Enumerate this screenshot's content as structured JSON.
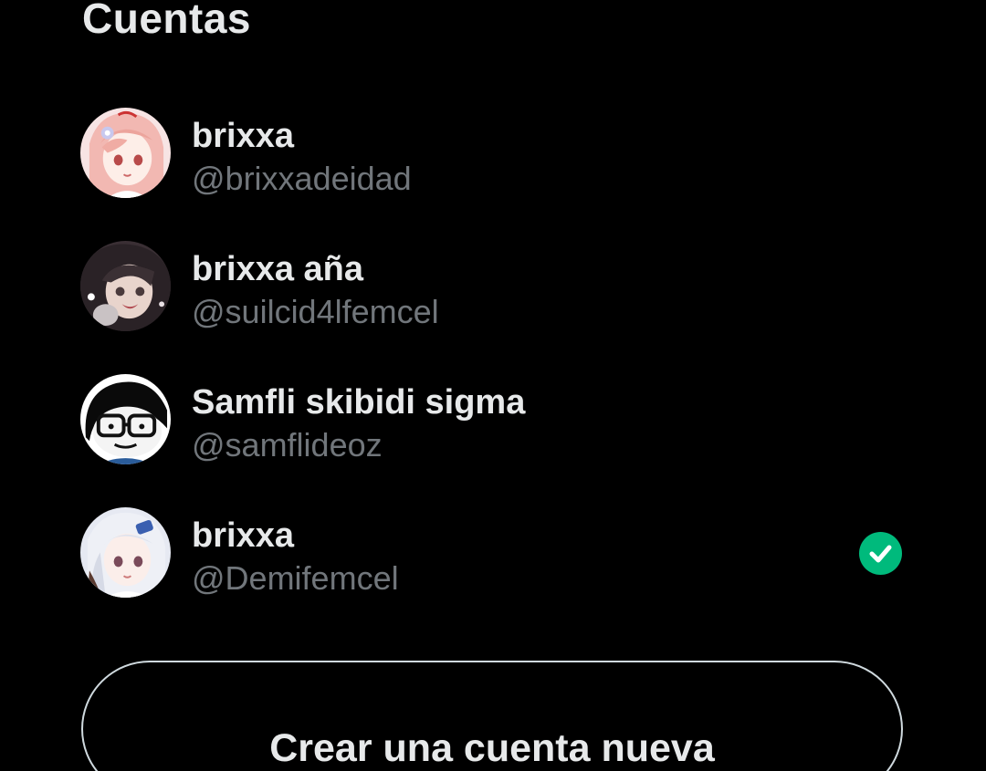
{
  "section_title": "Cuentas",
  "accounts": [
    {
      "name": "brixxa",
      "handle": "@brixxadeidad",
      "avatar_icon": "anime-girl-pink-hair-avatar",
      "selected": false
    },
    {
      "name": "brixxa aña",
      "handle": "@suilcid4lfemcel",
      "avatar_icon": "anime-girl-dark-hair-avatar",
      "selected": false
    },
    {
      "name": "Samfli skibidi sigma",
      "handle": "@samflideoz",
      "avatar_icon": "cartoon-boy-glasses-avatar",
      "selected": false
    },
    {
      "name": "brixxa",
      "handle": "@Demifemcel",
      "avatar_icon": "anime-girl-white-hair-avatar",
      "selected": true
    }
  ],
  "create_account_label": "Crear una cuenta nueva",
  "colors": {
    "background": "#000000",
    "primary_text": "#e7e9ea",
    "secondary_text": "#71767b",
    "check_green": "#00ba7c",
    "button_border": "#cfd9de"
  }
}
